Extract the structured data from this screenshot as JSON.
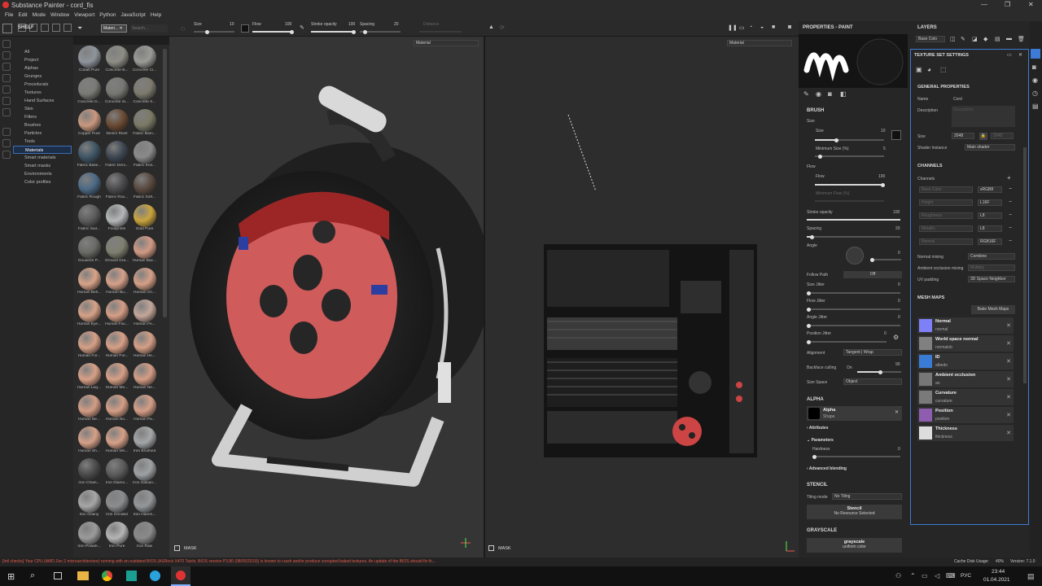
{
  "window": {
    "title": "Substance Painter - cord_fis"
  },
  "menu": [
    "File",
    "Edit",
    "Mode",
    "Window",
    "Viewport",
    "Python",
    "JavaScript",
    "Help"
  ],
  "toolbar": {
    "size_label": "Size",
    "size_value": "10",
    "flow_label": "Flow",
    "flow_value": "100",
    "stroke_label": "Stroke opacity",
    "stroke_value": "100",
    "spacing_label": "Spacing",
    "spacing_value": "20",
    "distance_label": "Distance"
  },
  "shelf": {
    "title": "SHELF",
    "filter_tag": "Materi...",
    "search_placeholder": "Search...",
    "categories": [
      "All",
      "Project",
      "Alphas",
      "Grunges",
      "Procedurals",
      "Textures",
      "Hand Surfaces",
      "Skin",
      "Filters",
      "Brushes",
      "Particles",
      "Tools",
      "Materials",
      "Smart materials",
      "Smart masks",
      "Environments",
      "Color profiles"
    ],
    "selected_category": "Materials",
    "items": [
      {
        "label": "Cobalt Pure",
        "color": "#8f959c"
      },
      {
        "label": "Concrete B...",
        "color": "#8e8e86"
      },
      {
        "label": "Concrete Cl...",
        "color": "#9a9a96"
      },
      {
        "label": "Concrete D...",
        "color": "#7a7a76"
      },
      {
        "label": "Concrete Si...",
        "color": "#777773"
      },
      {
        "label": "Concrete S...",
        "color": "#7d7a6e"
      },
      {
        "label": "Copper Pure",
        "color": "#c8987e"
      },
      {
        "label": "Denim Rivet",
        "color": "#6a4a33"
      },
      {
        "label": "Fabric Bam...",
        "color": "#7a7965"
      },
      {
        "label": "Fabric Base...",
        "color": "#3f5565"
      },
      {
        "label": "Fabric Deni...",
        "color": "#3d4651"
      },
      {
        "label": "Fabric Knit...",
        "color": "#8a8a8a"
      },
      {
        "label": "Fabric Rough",
        "color": "#4c6a85"
      },
      {
        "label": "Fabric Rou...",
        "color": "#4b4b4d"
      },
      {
        "label": "Fabric Soft...",
        "color": "#5a4a40"
      },
      {
        "label": "Fabric Suit...",
        "color": "#5c5c5c"
      },
      {
        "label": "Footprints",
        "color": "#b5b8b9"
      },
      {
        "label": "Gold Pure",
        "color": "#c9a43e"
      },
      {
        "label": "Gouache P...",
        "color": "#6a6a66"
      },
      {
        "label": "Ground Gra...",
        "color": "#7f8070"
      },
      {
        "label": "Human Bac...",
        "color": "#d19a84"
      },
      {
        "label": "Human Bell...",
        "color": "#d8a388"
      },
      {
        "label": "Human Bu...",
        "color": "#d6a18a"
      },
      {
        "label": "Human Ch...",
        "color": "#d59f86"
      },
      {
        "label": "Human Eye...",
        "color": "#d7a287"
      },
      {
        "label": "Human Fac...",
        "color": "#d59e86"
      },
      {
        "label": "Human Fe...",
        "color": "#c3a69a"
      },
      {
        "label": "Human For...",
        "color": "#d6a087"
      },
      {
        "label": "Human For...",
        "color": "#d7a087"
      },
      {
        "label": "Human He...",
        "color": "#d49f86"
      },
      {
        "label": "Human Leg...",
        "color": "#d7a086"
      },
      {
        "label": "Human Mo...",
        "color": "#d7a087"
      },
      {
        "label": "Human Ne...",
        "color": "#d49d85"
      },
      {
        "label": "Human Ne...",
        "color": "#d49d85"
      },
      {
        "label": "Human No...",
        "color": "#d59e86"
      },
      {
        "label": "Human Pa...",
        "color": "#d59e87"
      },
      {
        "label": "Human Sh...",
        "color": "#d6a088"
      },
      {
        "label": "Human Wri...",
        "color": "#d6a088"
      },
      {
        "label": "Iron Brushed",
        "color": "#a4a6a8"
      },
      {
        "label": "Iron Chain...",
        "color": "#4a4a4a"
      },
      {
        "label": "Iron Diamo...",
        "color": "#5b5b5b"
      },
      {
        "label": "Iron Galvan...",
        "color": "#9ea1a3"
      },
      {
        "label": "Iron Grainy",
        "color": "#a6a6a6"
      },
      {
        "label": "Iron Grinded",
        "color": "#8b8c8e"
      },
      {
        "label": "Iron Hamm...",
        "color": "#949698"
      },
      {
        "label": "Iron Powde...",
        "color": "#9b9b9b"
      },
      {
        "label": "Iron Pure",
        "color": "#b5b5b5"
      },
      {
        "label": "Iron Raw",
        "color": "#8a8a8a"
      }
    ]
  },
  "viewport": {
    "left_mode": "Material",
    "right_mode": "Material",
    "mask_label": "MASK",
    "mask_label_2": "MASK"
  },
  "properties": {
    "title": "PROPERTIES - PAINT",
    "brush_section": "BRUSH",
    "size_group": "Size",
    "size_label": "Size",
    "size_value": "10",
    "min_size_label": "Minimum Size (%)",
    "min_size_value": "5",
    "flow_group": "Flow",
    "flow_label": "Flow",
    "flow_value": "100",
    "min_flow_label": "Minimum Flow (%)",
    "stroke_opacity_label": "Stroke opacity",
    "stroke_opacity_value": "100",
    "spacing_label": "Spacing",
    "spacing_value": "20",
    "angle_label": "Angle",
    "angle_value": "0",
    "follow_path_label": "Follow Path",
    "follow_path_value": "Off",
    "size_jitter_label": "Size Jitter",
    "size_jitter_value": "0",
    "flow_jitter_label": "Flow Jitter",
    "flow_jitter_value": "0",
    "angle_jitter_label": "Angle Jitter",
    "angle_jitter_value": "0",
    "position_jitter_label": "Position Jitter",
    "position_jitter_value": "0",
    "alignment_label": "Alignment",
    "alignment_value": "Tangent | Wrap",
    "backface_label": "Backface culling",
    "backface_on": "On",
    "backface_value": "90",
    "size_space_label": "Size Space",
    "size_space_value": "Object",
    "alpha_section": "ALPHA",
    "alpha_name": "Alpha",
    "alpha_sub": "Shape",
    "attributes_label": "Attributes",
    "parameters_label": "Parameters",
    "hardness_label": "Hardness",
    "hardness_value": "0",
    "advanced_label": "Advanced blending",
    "stencil_section": "STENCIL",
    "tiling_label": "Tiling mode",
    "tiling_value": "No Tiling",
    "stencil_button_title": "Stencil",
    "stencil_button_sub": "No Resource Selected",
    "grayscale_section": "GRAYSCALE",
    "grayscale_title": "grayscale",
    "grayscale_sub": "uniform color"
  },
  "layers": {
    "title": "LAYERS",
    "channel_select": "Base Colo",
    "texture_set_title": "TEXTURE SET SETTINGS",
    "general_props": "GENERAL PROPERTIES",
    "name_label": "Name",
    "name_value": "Cord",
    "description_label": "Description",
    "description_placeholder": "Description",
    "size_label": "Size",
    "size_value": "2048",
    "size_locked_value": "2048",
    "shader_label": "Shader Instance",
    "shader_value": "Main shader",
    "channels_section": "CHANNELS",
    "channels_label": "Channels",
    "channels": [
      {
        "name": "Base Color",
        "format": "sRGB8"
      },
      {
        "name": "Height",
        "format": "L16F"
      },
      {
        "name": "Roughness",
        "format": "L8"
      },
      {
        "name": "Metallic",
        "format": "L8"
      },
      {
        "name": "Normal",
        "format": "RGB16F"
      }
    ],
    "normal_mixing_label": "Normal mixing",
    "normal_mixing_value": "Combine",
    "ao_mixing_label": "Ambient occlusion mixing",
    "ao_mixing_value": "Multiply",
    "uv_padding_label": "UV padding",
    "uv_padding_value": "3D Space Neighbor",
    "mesh_maps_section": "MESH MAPS",
    "bake_button": "Bake Mesh Maps",
    "mesh_maps": [
      {
        "name": "Normal",
        "sub": "normal",
        "color": "#7d80f6"
      },
      {
        "name": "World space normal",
        "sub": "normalob",
        "color": "#808080"
      },
      {
        "name": "ID",
        "sub": "albedo",
        "color": "#3a7bd5"
      },
      {
        "name": "Ambient occlusion",
        "sub": "ao",
        "color": "#777777"
      },
      {
        "name": "Curvature",
        "sub": "curvature",
        "color": "#7a7a7a"
      },
      {
        "name": "Position",
        "sub": "position",
        "color": "#8e5db0"
      },
      {
        "name": "Thickness",
        "sub": "thickness",
        "color": "#dddddd"
      }
    ]
  },
  "status": {
    "warning": "[Intl checks] Your CPU (AMD Zen 2 microarchitecture) running with an outdated BIOS (ASRock X470 Taichi, BIOS version P3.80 (08/05/2019)) is known to crash and/or produce corrupted baked textures. An update of the BIOS should fix th...",
    "cache": "Cache Disk Usage:",
    "cache_value": "40%",
    "version": "Version: 7.1.0"
  },
  "taskbar": {
    "lang": "РУС",
    "time": "23:44",
    "date": "01.04.2021"
  },
  "colors": {
    "accent": "#3d7bd6",
    "warning": "#d9534f"
  }
}
